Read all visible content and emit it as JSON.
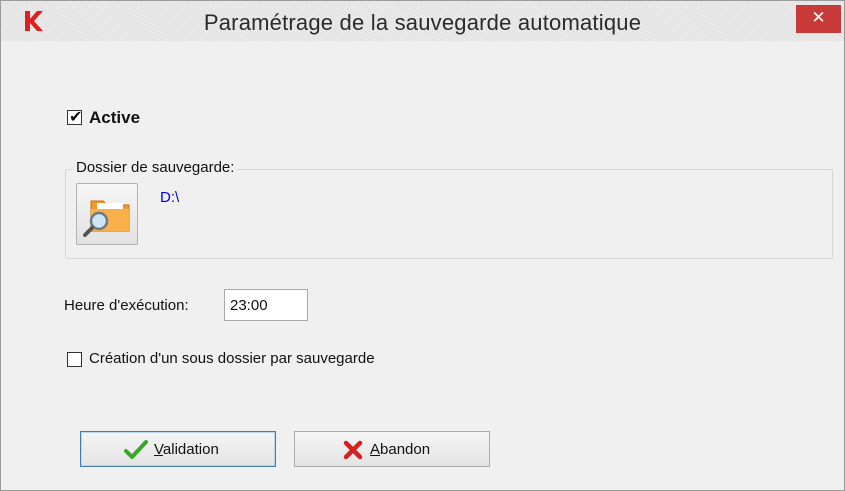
{
  "window": {
    "title": "Paramétrage de la sauvegarde automatique",
    "close_glyph": "✕",
    "close_color": "#c83a3a",
    "app_icon": "k-logo-icon"
  },
  "active": {
    "checked": true,
    "label": "Active"
  },
  "backup_folder": {
    "legend": "Dossier de sauvegarde:",
    "path": "D:\\",
    "path_color": "#0000ee",
    "button_icon": "folder-search-icon"
  },
  "schedule": {
    "label": "Heure d'exécution:",
    "value": "23:00"
  },
  "subfolder": {
    "checked": false,
    "label": "Création d'un sous dossier par sauvegarde"
  },
  "buttons": {
    "validate": {
      "mnemonic": "V",
      "rest": "alidation",
      "icon": "check-icon",
      "icon_color": "#3aa62a"
    },
    "abandon": {
      "mnemonic": "A",
      "rest": "bandon",
      "icon": "cross-icon",
      "icon_color": "#d42020"
    }
  }
}
